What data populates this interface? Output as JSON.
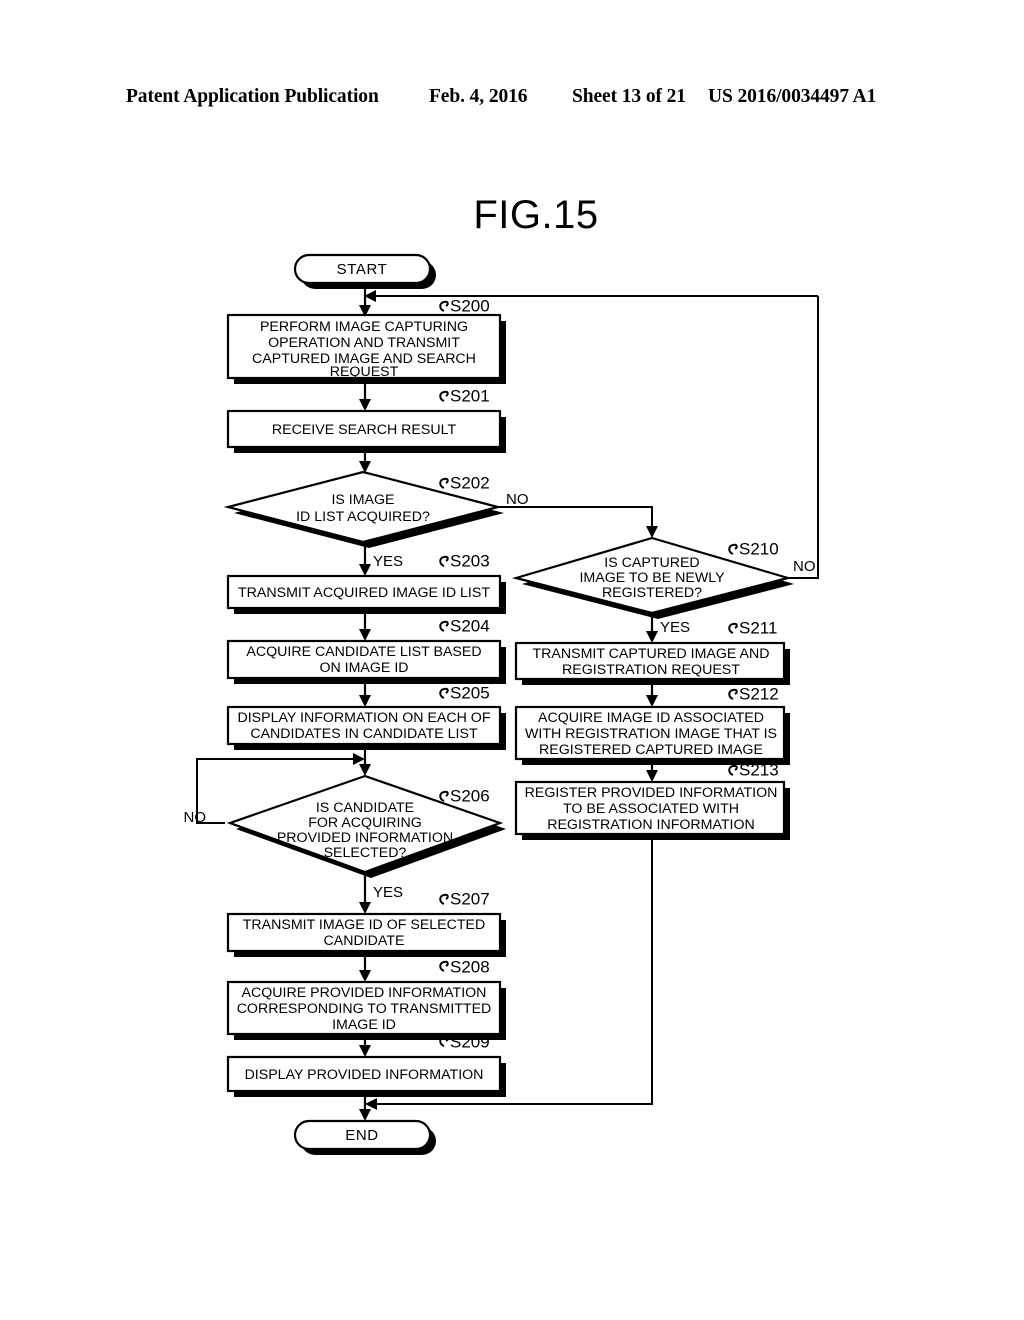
{
  "header": {
    "publication": "Patent Application Publication",
    "date": "Feb. 4, 2016",
    "sheet": "Sheet 13 of 21",
    "patent_number": "US 2016/0034497 A1"
  },
  "figure": {
    "title": "FIG.15"
  },
  "terminals": {
    "start": "START",
    "end": "END"
  },
  "branch_labels": {
    "s202_no": "NO",
    "s202_yes": "YES",
    "s206_no": "NO",
    "s206_yes": "YES",
    "s210_no": "NO",
    "s210_yes": "YES"
  },
  "steps": [
    {
      "id": "S200",
      "label": "S200",
      "shape": "process",
      "lines": [
        "PERFORM IMAGE CAPTURING",
        "OPERATION AND TRANSMIT",
        "CAPTURED IMAGE AND SEARCH",
        "REQUEST"
      ]
    },
    {
      "id": "S201",
      "label": "S201",
      "shape": "process",
      "lines": [
        "RECEIVE SEARCH RESULT"
      ]
    },
    {
      "id": "S202",
      "label": "S202",
      "shape": "decision",
      "lines": [
        "IS IMAGE",
        "ID LIST ACQUIRED?"
      ]
    },
    {
      "id": "S203",
      "label": "S203",
      "shape": "process",
      "lines": [
        "TRANSMIT ACQUIRED IMAGE ID LIST"
      ]
    },
    {
      "id": "S204",
      "label": "S204",
      "shape": "process",
      "lines": [
        "ACQUIRE CANDIDATE LIST BASED",
        "ON IMAGE ID"
      ]
    },
    {
      "id": "S205",
      "label": "S205",
      "shape": "process",
      "lines": [
        "DISPLAY INFORMATION ON EACH OF",
        "CANDIDATES IN CANDIDATE LIST"
      ]
    },
    {
      "id": "S206",
      "label": "S206",
      "shape": "decision",
      "lines": [
        "IS CANDIDATE",
        "FOR ACQUIRING",
        "PROVIDED INFORMATION",
        "SELECTED?"
      ]
    },
    {
      "id": "S207",
      "label": "S207",
      "shape": "process",
      "lines": [
        "TRANSMIT IMAGE ID OF SELECTED",
        "CANDIDATE"
      ]
    },
    {
      "id": "S208",
      "label": "S208",
      "shape": "process",
      "lines": [
        "ACQUIRE PROVIDED INFORMATION",
        "CORRESPONDING TO TRANSMITTED",
        "IMAGE ID"
      ]
    },
    {
      "id": "S209",
      "label": "S209",
      "shape": "process",
      "lines": [
        "DISPLAY PROVIDED INFORMATION"
      ]
    },
    {
      "id": "S210",
      "label": "S210",
      "shape": "decision",
      "lines": [
        "IS CAPTURED",
        "IMAGE TO BE NEWLY",
        "REGISTERED?"
      ]
    },
    {
      "id": "S211",
      "label": "S211",
      "shape": "process",
      "lines": [
        "TRANSMIT CAPTURED IMAGE AND",
        "REGISTRATION REQUEST"
      ]
    },
    {
      "id": "S212",
      "label": "S212",
      "shape": "process",
      "lines": [
        "ACQUIRE IMAGE ID ASSOCIATED",
        "WITH REGISTRATION IMAGE THAT IS",
        "REGISTERED CAPTURED IMAGE"
      ]
    },
    {
      "id": "S213",
      "label": "S213",
      "shape": "process",
      "lines": [
        "REGISTER PROVIDED INFORMATION",
        "TO BE ASSOCIATED WITH",
        "REGISTRATION INFORMATION"
      ]
    }
  ],
  "colors": {
    "ink": "#000000",
    "paper": "#ffffff"
  }
}
